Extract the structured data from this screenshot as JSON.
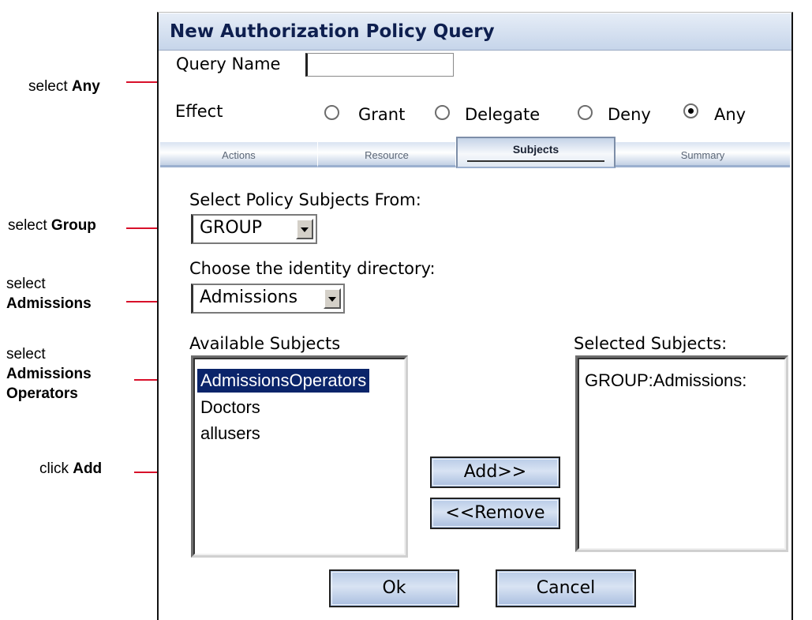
{
  "dialog": {
    "title": "New Authorization Policy Query",
    "query_name_label": "Query Name",
    "query_name_value": "",
    "effect_label": "Effect",
    "effect_options": [
      {
        "label": "Grant",
        "checked": false
      },
      {
        "label": "Delegate",
        "checked": false
      },
      {
        "label": "Deny",
        "checked": false
      },
      {
        "label": "Any",
        "checked": true
      }
    ],
    "tabs": [
      {
        "label": "Actions",
        "active": false
      },
      {
        "label": "Resource",
        "active": false
      },
      {
        "label": "Subjects",
        "active": true
      },
      {
        "label": "Summary",
        "active": false
      }
    ],
    "subjects_from_label": "Select Policy Subjects From:",
    "subjects_from_value": "GROUP",
    "directory_label": "Choose the identity directory:",
    "directory_value": "Admissions",
    "available_label": "Available Subjects",
    "available_items": [
      {
        "label": "AdmissionsOperators",
        "selected": true
      },
      {
        "label": "Doctors",
        "selected": false
      },
      {
        "label": "allusers",
        "selected": false
      }
    ],
    "selected_label": "Selected Subjects:",
    "selected_items": [
      "GROUP:Admissions:"
    ],
    "add_button": "Add>>",
    "remove_button": "<<Remove",
    "ok_button": "Ok",
    "cancel_button": "Cancel"
  },
  "callouts": {
    "any": {
      "prefix": "select ",
      "bold": "Any"
    },
    "group": {
      "prefix": "select ",
      "bold": "Group"
    },
    "admissions": {
      "prefix": "select",
      "bold": "Admissions"
    },
    "operators": {
      "prefix": "select",
      "bold1": "Admissions",
      "bold2": "Operators"
    },
    "add": {
      "prefix": "click ",
      "bold": "Add"
    }
  },
  "colors": {
    "callout_line": "#d8102a",
    "selection": "#0a246a",
    "title_text": "#0e1f4f"
  }
}
